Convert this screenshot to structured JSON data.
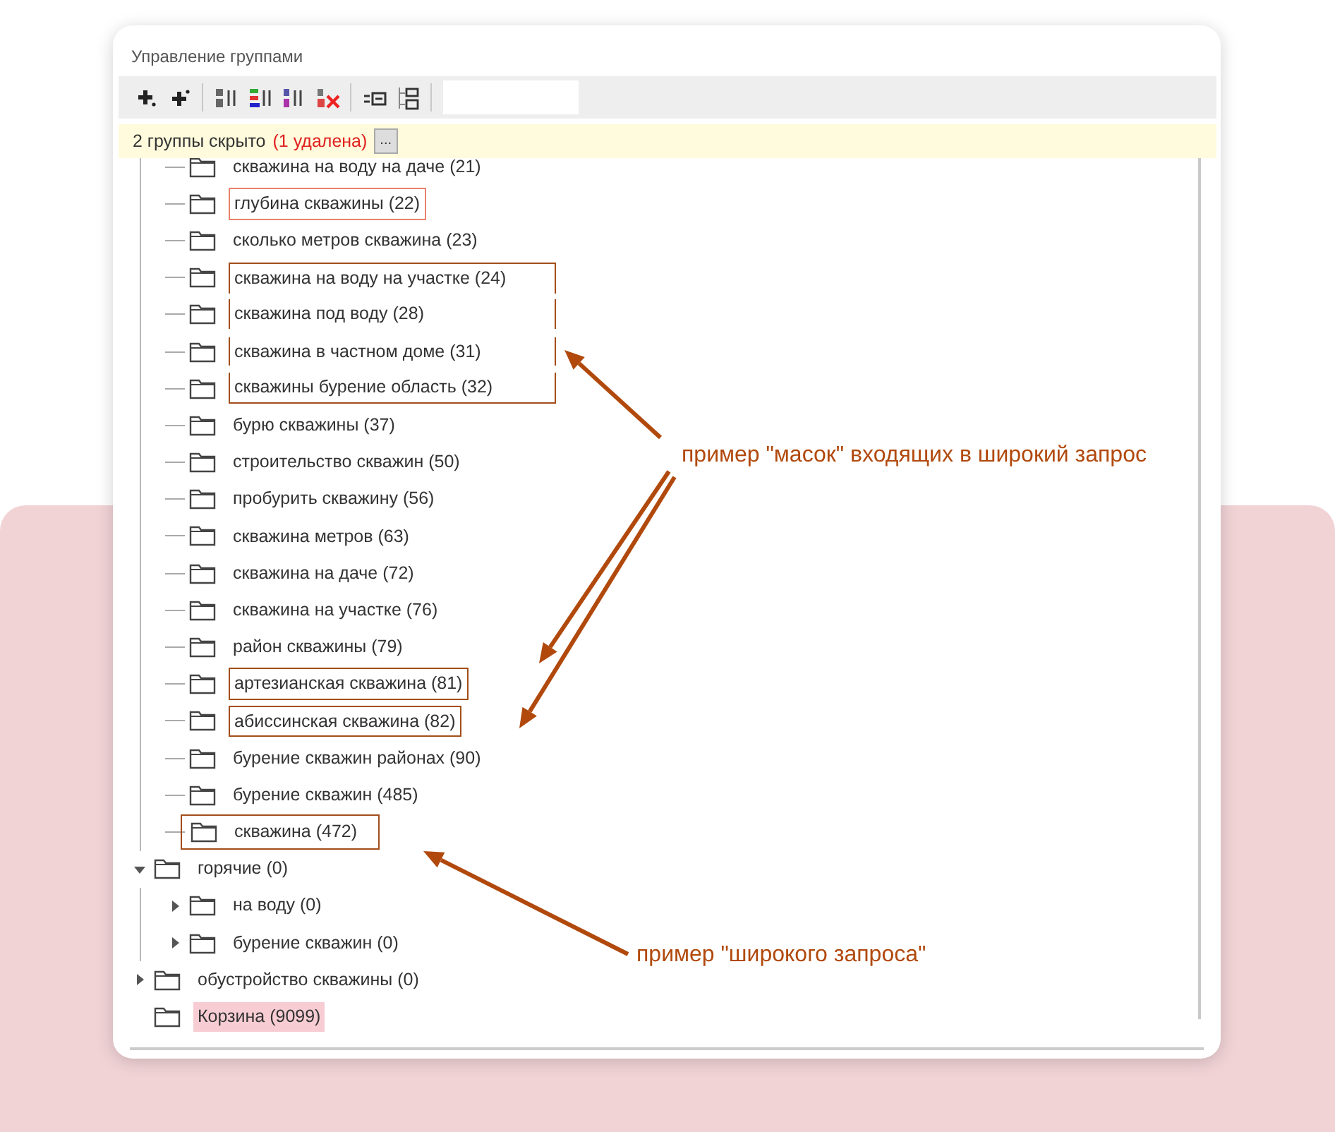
{
  "window": {
    "title": "Управление группами"
  },
  "toolbar": {
    "buttons": [
      {
        "kind": "add"
      },
      {
        "kind": "add-child"
      },
      {
        "kind": "separator"
      },
      {
        "kind": "sort-alpha"
      },
      {
        "kind": "sort-color"
      },
      {
        "kind": "sort-number"
      },
      {
        "kind": "clear-sort"
      },
      {
        "kind": "separator"
      },
      {
        "kind": "collapse"
      },
      {
        "kind": "tree"
      },
      {
        "kind": "separator"
      }
    ],
    "search_field": true
  },
  "info_bar": {
    "text": "2 группы скрыто",
    "note": "(1 удалена)",
    "button": "..."
  },
  "tree": [
    {
      "children": [
        {
          "label": "скважина на воду на даче (21)",
          "framed": false
        },
        {
          "label": "глубина скважины (22)",
          "framed": true,
          "color": "#e8826c"
        },
        {
          "label": "сколько метров скважина (23)",
          "framed": false
        },
        {
          "label": "скважина на воду на участке (24)",
          "framed": true,
          "color": "#a24e19",
          "joined_above": false,
          "joined_below": true
        },
        {
          "label": "скважина под воду (28)",
          "framed": true,
          "color": "#a24e19",
          "joined_above": true,
          "joined_below": true
        },
        {
          "label": "скважина в частном доме (31)",
          "framed": true,
          "color": "#a24e19",
          "joined_above": true,
          "joined_below": true
        },
        {
          "label": "скважины бурение область (32)",
          "framed": true,
          "color": "#a24e19",
          "joined_above": true,
          "joined_below": false
        },
        {
          "label": "бурю скважины (37)",
          "framed": false
        },
        {
          "label": "строительство скважин (50)",
          "framed": false
        },
        {
          "label": "пробурить скважину (56)",
          "framed": false
        },
        {
          "label": "скважина метров (63)",
          "framed": false
        },
        {
          "label": "скважина на даче (72)",
          "framed": false
        },
        {
          "label": "скважина на участке (76)",
          "framed": false
        },
        {
          "label": "район скважины (79)",
          "framed": false
        },
        {
          "label": "артезианская скважина (81)",
          "framed": true,
          "color": "#a24e19"
        },
        {
          "label": "абиссинская скважина (82)",
          "framed": true,
          "color": "#a24e19"
        },
        {
          "label": "бурение скважин районах (90)",
          "framed": false
        },
        {
          "label": "бурение скважин (485)",
          "framed": false
        },
        {
          "label": "скважина (472)",
          "framed": true,
          "color": "#a24e19",
          "icon_framed": true
        }
      ]
    },
    {
      "label": "горячие (0)",
      "expanded": true,
      "children": [
        {
          "label": "на воду (0)",
          "expanded": false
        },
        {
          "label": "бурение скважин (0)",
          "expanded": false
        }
      ]
    },
    {
      "label": "обустройство скважины (0)",
      "expanded": false
    },
    {
      "label": "Корзина (9099)",
      "highlighted": true
    }
  ],
  "annotations": [
    {
      "text": "пример \"масок\" входящих в широкий запрос",
      "kind": "masks"
    },
    {
      "text": "пример \"широкого запроса\"",
      "kind": "broad"
    }
  ]
}
